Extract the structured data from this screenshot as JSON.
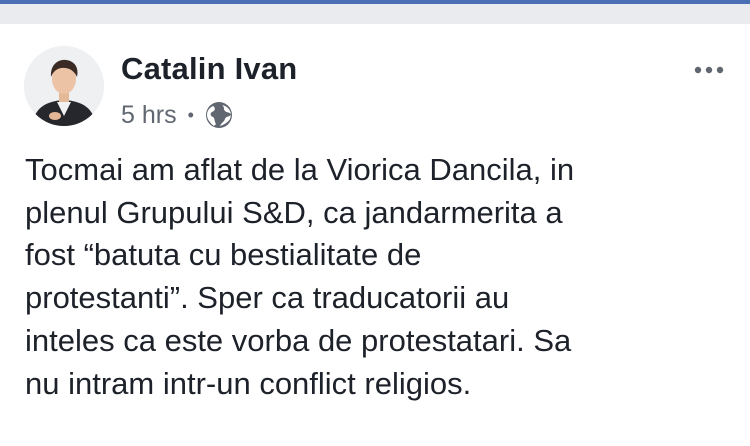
{
  "post": {
    "author": "Catalin Ivan",
    "time": "5 hrs",
    "separator": "•",
    "privacy_icon": "globe-icon",
    "more_icon": "more-options-icon",
    "text": "Tocmai am aflat de la Viorica Dancila, in\nplenul Grupului S&D, ca jandarmerita a\nfost “batuta cu bestialitate de\nprotestanti”. Sper ca traducatorii au\ninteles ca este vorba de protestatari. Sa\nnu intram intr-un conflict religios."
  },
  "colors": {
    "top_bar": "#4a6fb5",
    "feed_background": "#e9ebee",
    "text_primary": "#1d2129",
    "text_secondary": "#606770"
  }
}
